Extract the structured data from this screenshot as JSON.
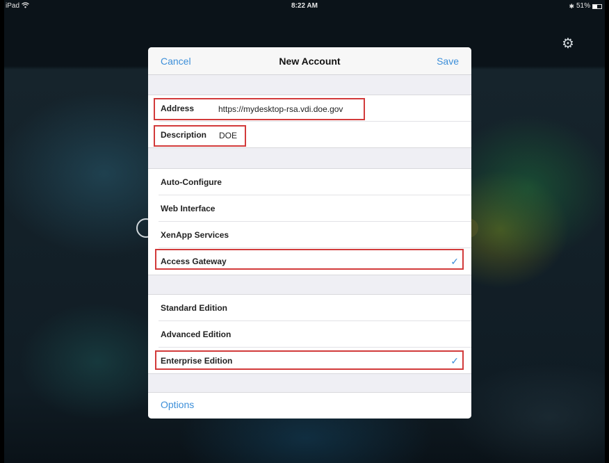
{
  "status_bar": {
    "device": "iPad",
    "time": "8:22 AM",
    "battery": "51%",
    "battery_level": 0.51
  },
  "icons": {
    "wifi": "wifi-icon",
    "bluetooth": "bluetooth-icon",
    "settings": "gear-icon"
  },
  "dialog": {
    "cancel_label": "Cancel",
    "title": "New Account",
    "save_label": "Save",
    "address": {
      "label": "Address",
      "value": "https://mydesktop-rsa.vdi.doe.gov"
    },
    "description": {
      "label": "Description",
      "value": "DOE"
    },
    "connection_types": [
      {
        "label": "Auto-Configure",
        "selected": false
      },
      {
        "label": "Web Interface",
        "selected": false
      },
      {
        "label": "XenApp Services",
        "selected": false
      },
      {
        "label": "Access Gateway",
        "selected": true
      }
    ],
    "editions": [
      {
        "label": "Standard Edition",
        "selected": false
      },
      {
        "label": "Advanced Edition",
        "selected": false
      },
      {
        "label": "Enterprise Edition",
        "selected": true
      }
    ],
    "options_label": "Options",
    "checkmark": "✓"
  },
  "colors": {
    "accent": "#3d8fd9",
    "highlight": "#d23a3a"
  }
}
